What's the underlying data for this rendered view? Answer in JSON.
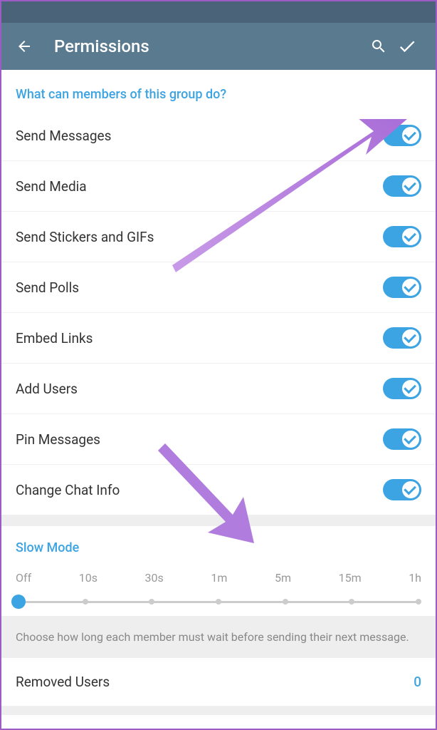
{
  "header": {
    "title": "Permissions"
  },
  "section_header": "What can members of this group do?",
  "permissions": [
    {
      "label": "Send Messages",
      "on": true
    },
    {
      "label": "Send Media",
      "on": true
    },
    {
      "label": "Send Stickers and GIFs",
      "on": true
    },
    {
      "label": "Send Polls",
      "on": true
    },
    {
      "label": "Embed Links",
      "on": true
    },
    {
      "label": "Add Users",
      "on": true
    },
    {
      "label": "Pin Messages",
      "on": true
    },
    {
      "label": "Change Chat Info",
      "on": true
    }
  ],
  "slow_mode": {
    "title": "Slow Mode",
    "options": [
      "Off",
      "10s",
      "30s",
      "1m",
      "5m",
      "15m",
      "1h"
    ],
    "selected_index": 0,
    "help": "Choose how long each member must wait before sending their next message."
  },
  "removed": {
    "label": "Removed Users",
    "count": "0"
  }
}
